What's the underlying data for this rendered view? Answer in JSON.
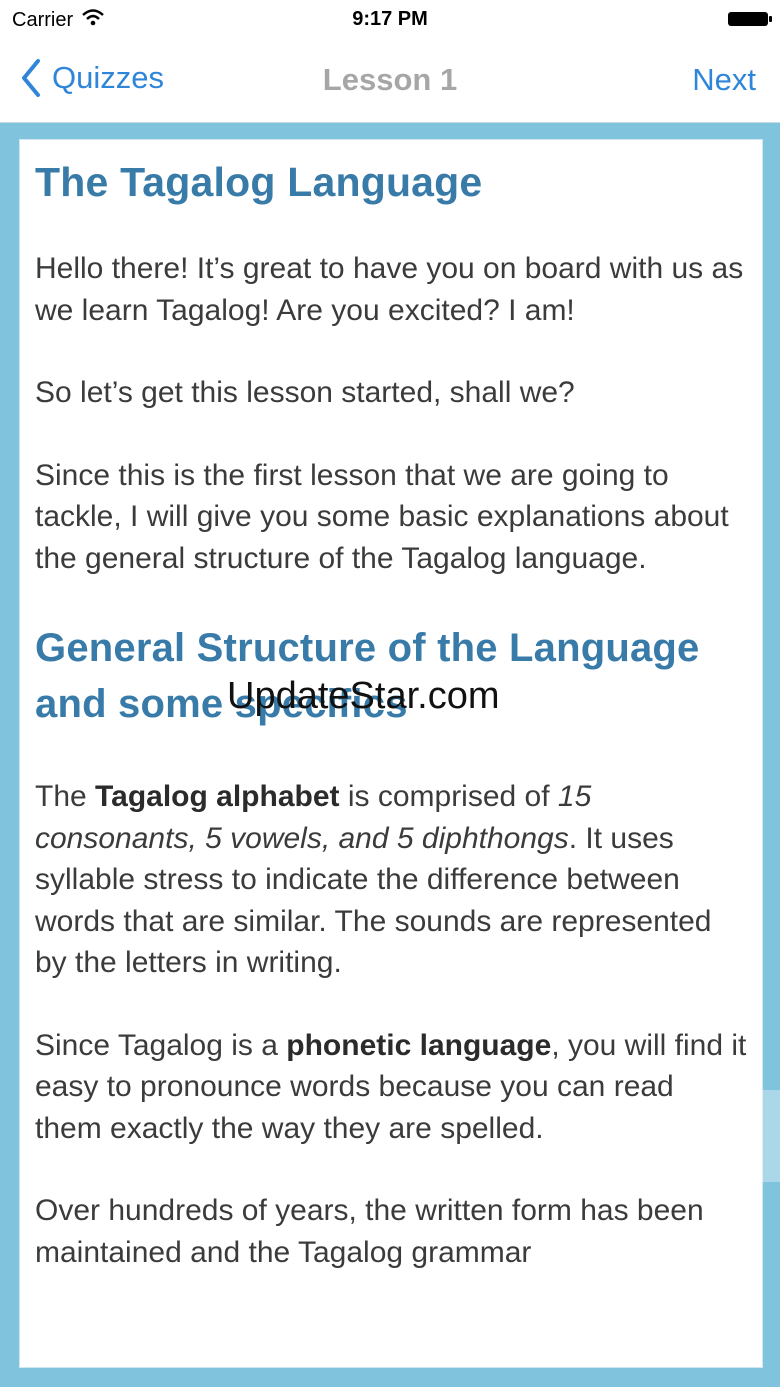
{
  "status_bar": {
    "carrier": "Carrier",
    "time": "9:17 PM",
    "wifi_icon": "wifi-icon",
    "battery_icon": "battery-icon"
  },
  "nav": {
    "back_label": "Quizzes",
    "title": "Lesson 1",
    "next_label": "Next"
  },
  "article": {
    "title": "The Tagalog Language",
    "para1": "Hello there! It’s great to have you on board with us as we learn Tagalog! Are you excited? I am!",
    "para2": "So let’s get this lesson started, shall we?",
    "para3": "Since this is the first lesson that we are going to tackle, I will give you some basic explanations about the general structure of the Tagalog language.",
    "section_heading": "General Structure of the Language and some specifics",
    "para4": {
      "part1": "The ",
      "bold": "Tagalog alphabet",
      "part2": " is comprised of ",
      "italic": "15 consonants, 5 vowels, and 5 diphthongs",
      "part3": ". It uses syllable stress to indicate the difference between words that are similar. The sounds are represented by the letters in writing."
    },
    "para5": {
      "part1": "Since Tagalog is a ",
      "bold": "phonetic language",
      "part2": ", you will find it easy to pronounce words because you can read them exactly the way they are spelled."
    },
    "para6": "Over hundreds of years, the written form has been maintained and the Tagalog grammar"
  },
  "watermark": "UpdateStar.com",
  "colors": {
    "background": "#7fc3dc",
    "accent": "#2f86d9",
    "heading": "#387ba8",
    "body_text": "#3b3b3b"
  }
}
